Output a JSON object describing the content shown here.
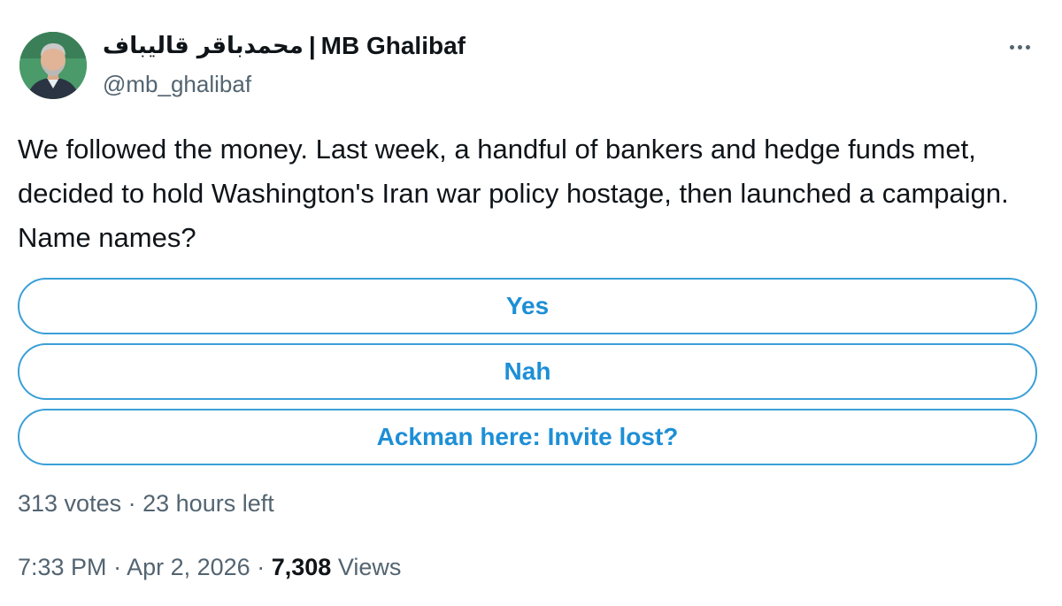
{
  "author": {
    "name_arabic": "محمدباقر قالیباف",
    "separator": "|",
    "name_latin": "MB Ghalibaf",
    "handle": "@mb_ghalibaf"
  },
  "tweet": {
    "text": "We followed the money. Last week, a handful of bankers and hedge funds met, decided to hold Washington's Iran war policy hostage, then launched a campaign. Name names?"
  },
  "poll": {
    "options": [
      {
        "label": "Yes"
      },
      {
        "label": "Nah"
      },
      {
        "label": "Ackman here: Invite lost?"
      }
    ],
    "votes": "313 votes",
    "dot": "·",
    "time_left": "23 hours left"
  },
  "meta": {
    "time": "7:33 PM",
    "dot": "·",
    "date": "Apr 2, 2026",
    "views_count": "7,308",
    "views_label": "Views"
  },
  "colors": {
    "accent": "#1d8fd6",
    "secondary_text": "#536471",
    "primary_text": "#0f1419"
  },
  "icons": {
    "more": "more-horizontal-icon",
    "avatar": "profile-photo"
  }
}
